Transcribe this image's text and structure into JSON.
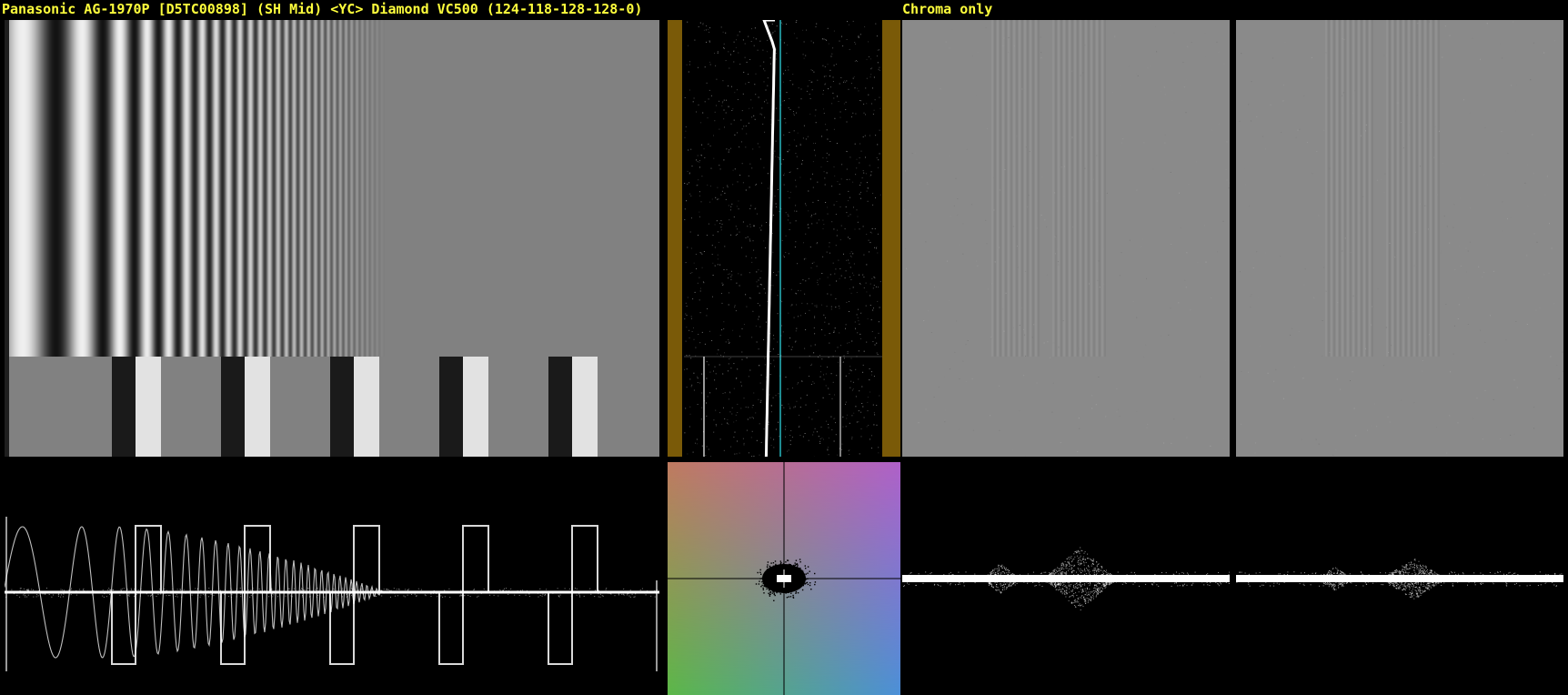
{
  "header": {
    "title": "Panasonic AG-1970P [D5TC00898] (SH Mid) <YC> Diamond VC500 (124-118-128-128-0)",
    "mode_label": "Chroma only"
  },
  "panels": {
    "video_frame": "video-frame-view",
    "waveform": "luma-waveform",
    "vectorscope": "vectorscope",
    "chroma_frame_a": "chroma-frame-a",
    "chroma_frame_b": "chroma-frame-b",
    "chroma_wave_a": "chroma-waveform-a",
    "chroma_wave_b": "chroma-waveform-b",
    "vertical_profile": "vertical-profile"
  },
  "colors": {
    "header_text": "#ffff3c",
    "profile_border": "#7a5a08",
    "profile_trace": "#28b8c0",
    "mid_gray": "#808080"
  }
}
